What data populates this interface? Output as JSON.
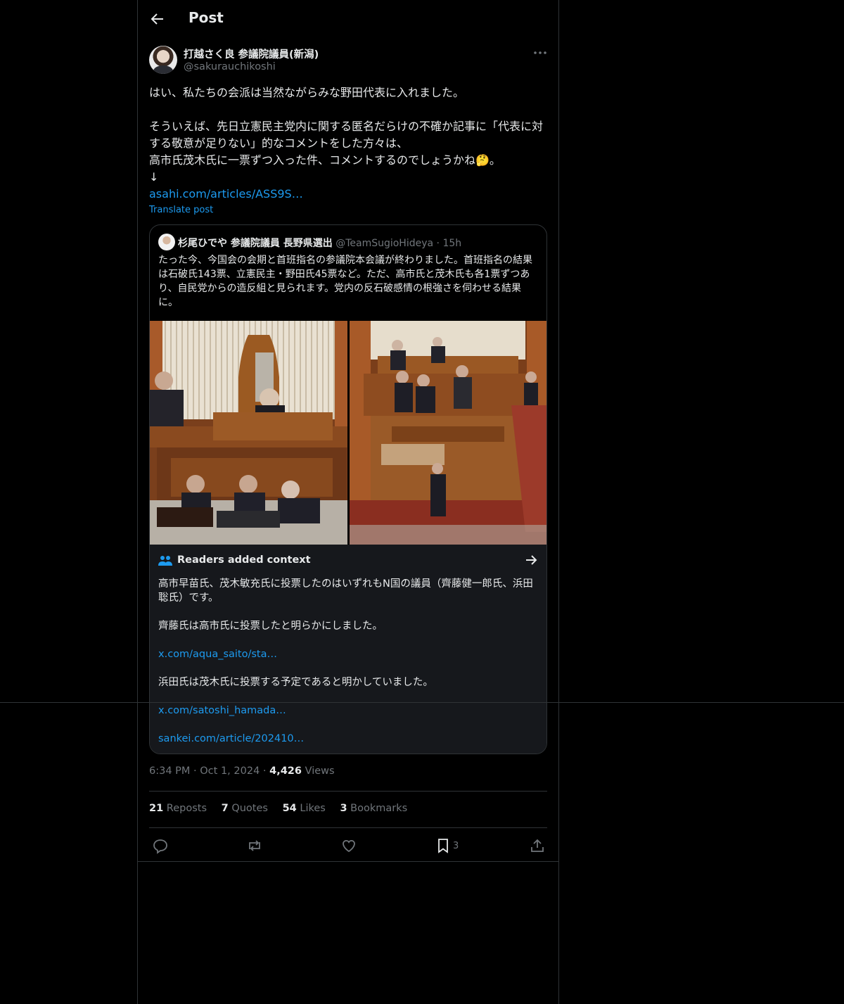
{
  "header": {
    "title": "Post"
  },
  "author": {
    "name": "打越さく良 参議院議員(新潟)",
    "handle": "@sakurauchikoshi"
  },
  "post": {
    "line1": "はい、私たちの会派は当然ながらみな野田代表に入れました。",
    "line2": "そういえば、先日立憲民主党内に関する匿名だらけの不確か記事に「代表に対する敬意が足りない」的なコメントをした方々は、",
    "line3": "高市氏茂木氏に一票ずつ入った件、コメントするのでしょうかね🤔。",
    "arrow": "↓",
    "link": "asahi.com/articles/ASS9S…",
    "translate": "Translate post"
  },
  "quote": {
    "name": "杉尾ひでや 参議院議員 長野県選出",
    "handle": "@TeamSugioHideya",
    "sep": "·",
    "time": "15h",
    "text": "たった今、今国会の会期と首班指名の参議院本会議が終わりました。首班指名の結果は石破氏143票、立憲民主・野田氏45票など。ただ、高市氏と茂木氏も各1票ずつあり、自民党からの造反組と見られます。党内の反石破感情の根強さを伺わせる結果に。"
  },
  "context": {
    "title": "Readers added context",
    "p1": "高市早苗氏、茂木敏充氏に投票したのはいずれもN国の議員（齊藤健一郎氏、浜田聡氏）です。",
    "p2": "齊藤氏は高市氏に投票したと明らかにしました。",
    "link1": "x.com/aqua_saito/sta…",
    "p3": "浜田氏は茂木氏に投票する予定であると明かしていました。",
    "link2": "x.com/satoshi_hamada…",
    "link3": "sankei.com/article/202410…"
  },
  "meta": {
    "time": "6:34 PM",
    "sep": "·",
    "date": "Oct 1, 2024",
    "views_count": "4,426",
    "views_label": "Views"
  },
  "stats": {
    "reposts_count": "21",
    "reposts_label": "Reposts",
    "quotes_count": "7",
    "quotes_label": "Quotes",
    "likes_count": "54",
    "likes_label": "Likes",
    "bookmarks_count": "3",
    "bookmarks_label": "Bookmarks"
  },
  "actions": {
    "bookmark_count": "3"
  },
  "colors": {
    "link": "#1d9bf0",
    "muted": "#71767b",
    "border": "#2f3336",
    "text": "#e7e9ea",
    "context_bg": "#16181c"
  }
}
